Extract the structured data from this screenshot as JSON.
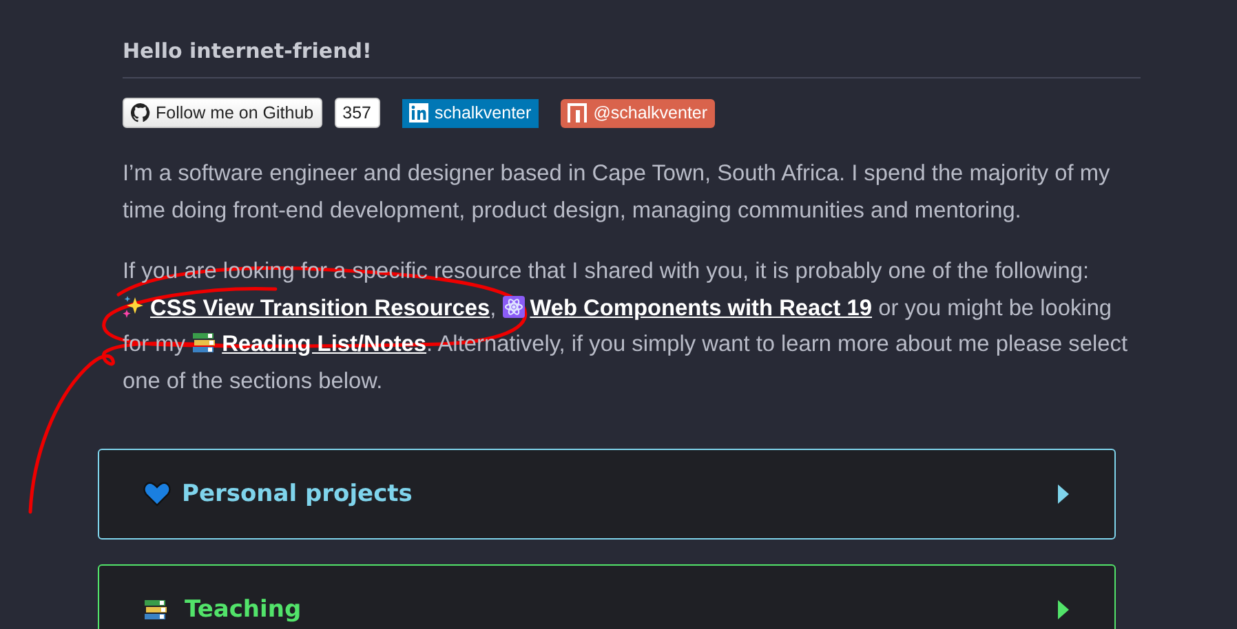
{
  "greeting": "Hello internet-friend!",
  "badges": [
    {
      "kind": "github",
      "label": "Follow me on Github",
      "count": "357"
    },
    {
      "kind": "linkedin",
      "label": "schalkventer"
    },
    {
      "kind": "npm",
      "label": "@schalkventer"
    }
  ],
  "intro": "I’m a software engineer and designer based in Cape Town, South Africa. I spend the majority of my time doing front-end development, product design, managing communities and mentoring.",
  "resources": [
    {
      "kind": "text",
      "text": "If you are looking for a specific resource that I shared with you, it is probably one of the following:"
    },
    {
      "kind": "sparkles",
      "text": "CSS View Transition Resources"
    },
    {
      "kind": "text",
      "text": ","
    },
    {
      "kind": "atom",
      "text": "Web Components with React 19"
    },
    {
      "kind": "text",
      "text": "or you might be looking for my"
    },
    {
      "kind": "books",
      "text": "Reading List/Notes"
    },
    {
      "kind": "text",
      "text": ". Alternatively, if you simply want to learn more about me please select one of the sections below."
    }
  ],
  "sections": [
    {
      "kind": "heart",
      "title": "Personal projects",
      "color": "#7fd4ec",
      "expanded": false
    },
    {
      "kind": "books",
      "title": "Teaching",
      "color": "#52e36a",
      "expanded": false
    }
  ]
}
